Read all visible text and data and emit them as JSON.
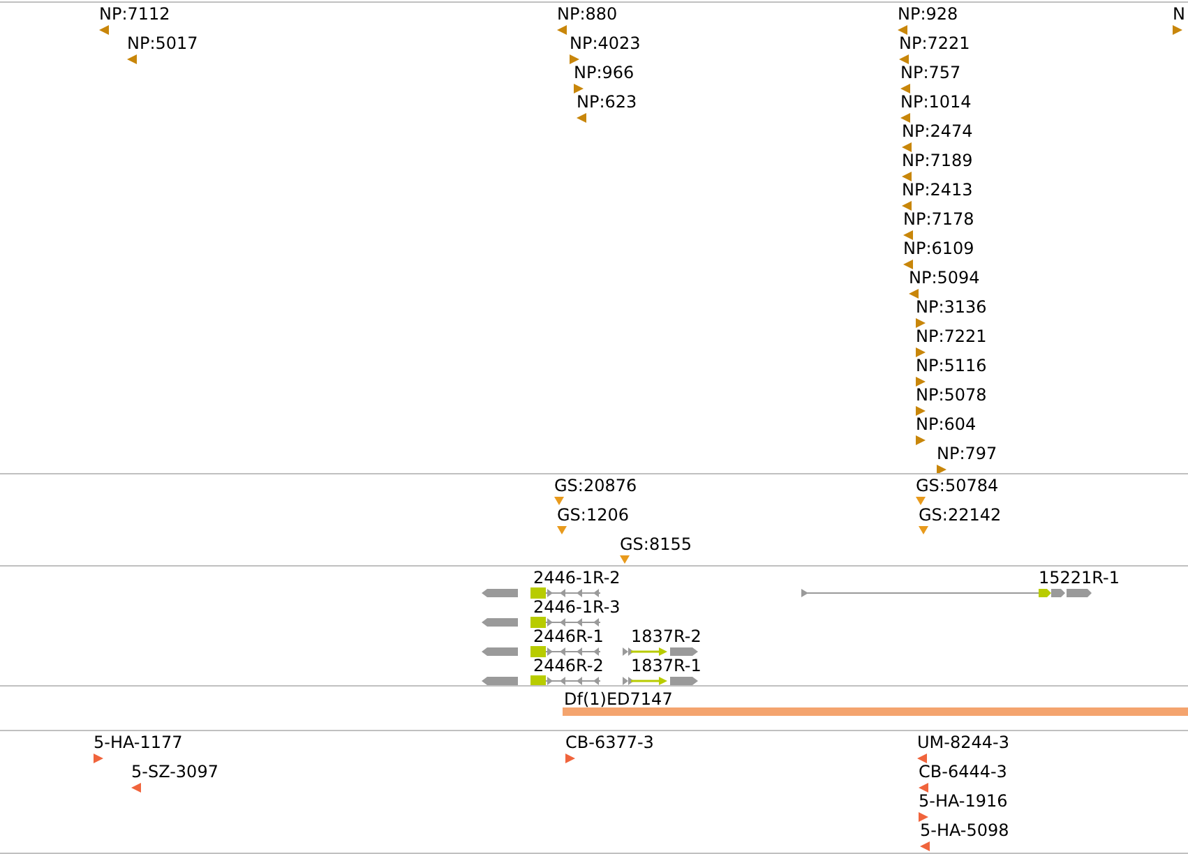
{
  "tracks": [
    {
      "kind": "features",
      "color": "#c8860a",
      "features": [
        {
          "label": "NP:7112",
          "kind": "reverse"
        },
        {
          "label": "NP:5017",
          "kind": "reverse"
        },
        {
          "label": "NP:880",
          "kind": "reverse"
        },
        {
          "label": "NP:4023",
          "kind": "forward"
        },
        {
          "label": "NP:966",
          "kind": "forward"
        },
        {
          "label": "NP:623",
          "kind": "reverse"
        },
        {
          "label": "NP:928",
          "kind": "reverse"
        },
        {
          "label": "NP:7221",
          "kind": "reverse"
        },
        {
          "label": "NP:757",
          "kind": "reverse"
        },
        {
          "label": "NP:1014",
          "kind": "reverse"
        },
        {
          "label": "NP:2474",
          "kind": "reverse"
        },
        {
          "label": "NP:7189",
          "kind": "reverse"
        },
        {
          "label": "NP:2413",
          "kind": "reverse"
        },
        {
          "label": "NP:7178",
          "kind": "reverse"
        },
        {
          "label": "NP:6109",
          "kind": "reverse"
        },
        {
          "label": "NP:5094",
          "kind": "reverse"
        },
        {
          "label": "NP:3136",
          "kind": "forward"
        },
        {
          "label": "NP:7221",
          "kind": "forward"
        },
        {
          "label": "NP:5116",
          "kind": "forward"
        },
        {
          "label": "NP:5078",
          "kind": "forward"
        },
        {
          "label": "NP:604",
          "kind": "forward"
        },
        {
          "label": "NP:797",
          "kind": "forward"
        },
        {
          "label": "N",
          "kind": "forward"
        }
      ]
    },
    {
      "kind": "features",
      "color": "#e89a1c",
      "features": [
        {
          "label": "GS:20876",
          "kind": "point"
        },
        {
          "label": "GS:1206",
          "kind": "point"
        },
        {
          "label": "GS:8155",
          "kind": "point"
        },
        {
          "label": "GS:50784",
          "kind": "point"
        },
        {
          "label": "GS:22142",
          "kind": "point"
        }
      ]
    },
    {
      "kind": "genes",
      "color": "#b8cc00",
      "features": [
        {
          "label": "2446-1R-2",
          "kind": "reverse"
        },
        {
          "label": "2446-1R-3",
          "kind": "reverse"
        },
        {
          "label": "2446R-1",
          "kind": "reverse"
        },
        {
          "label": "1837R-2",
          "kind": "forward"
        },
        {
          "label": "2446R-2",
          "kind": "reverse"
        },
        {
          "label": "1837R-1",
          "kind": "forward"
        },
        {
          "label": "15221R-1",
          "kind": "long"
        }
      ]
    },
    {
      "kind": "deficiency",
      "color": "#f4a46e",
      "features": [
        {
          "label": "Df(1)ED7147"
        }
      ]
    },
    {
      "kind": "features",
      "color": "#f0643c",
      "features": [
        {
          "label": "5-HA-1177",
          "kind": "forward"
        },
        {
          "label": "5-SZ-3097",
          "kind": "reverse"
        },
        {
          "label": "CB-6377-3",
          "kind": "forward"
        },
        {
          "label": "UM-8244-3",
          "kind": "reverse"
        },
        {
          "label": "CB-6444-3",
          "kind": "reverse"
        },
        {
          "label": "5-HA-1916",
          "kind": "forward"
        },
        {
          "label": "5-HA-5098",
          "kind": "reverse"
        }
      ]
    }
  ]
}
